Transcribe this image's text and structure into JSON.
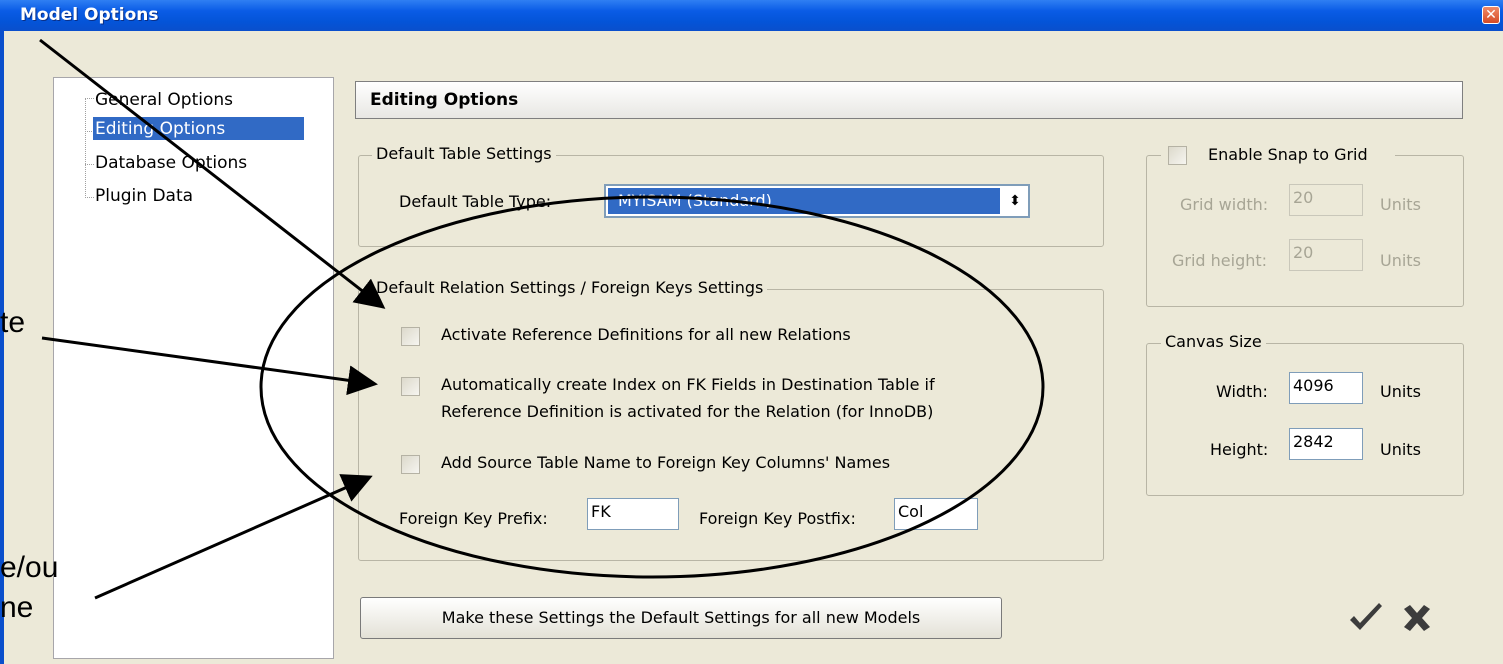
{
  "window": {
    "title": "Model Options",
    "close_glyph": "✕"
  },
  "tree": {
    "items": [
      {
        "label": "General Options",
        "selected": false
      },
      {
        "label": "Editing Options",
        "selected": true
      },
      {
        "label": "Database Options",
        "selected": false
      },
      {
        "label": "Plugin Data",
        "selected": false
      }
    ]
  },
  "header": {
    "title": "Editing Options"
  },
  "table_settings": {
    "legend": "Default Table Settings",
    "type_label": "Default Table Type:",
    "type_value": "MYISAM (Standard)",
    "arrow_glyph": "⬍"
  },
  "relation_settings": {
    "legend": "Default Relation Settings / Foreign Keys Settings",
    "option1": "Activate Reference Definitions for all new Relations",
    "option2_line1": "Automatically create Index on FK Fields in Destination Table if",
    "option2_line2": "Reference Definition is activated for the Relation (for InnoDB)",
    "option3": "Add Source Table Name to Foreign Key Columns' Names",
    "prefix_label": "Foreign Key Prefix:",
    "prefix_value": "FK",
    "postfix_label": "Foreign Key Postfix:",
    "postfix_value": "Col"
  },
  "grid": {
    "legend": "Enable Snap to Grid",
    "width_label": "Grid width:",
    "width_value": "20",
    "height_label": "Grid height:",
    "height_value": "20",
    "units": "Units"
  },
  "canvas": {
    "legend": "Canvas Size",
    "width_label": "Width:",
    "width_value": "4096",
    "height_label": "Height:",
    "height_value": "2842",
    "units": "Units"
  },
  "buttons": {
    "make_default": "Make these Settings the Default Settings for all new Models"
  },
  "icons": {
    "ok": "checkmark-icon",
    "cancel": "cross-icon"
  },
  "annotation_fragments": {
    "frag1": "te",
    "frag2": "e/ou",
    "frag3": "ne"
  },
  "colors": {
    "title_bar": "#0a5ce6",
    "selection": "#316ac5",
    "dialog_bg": "#ece9d8"
  }
}
